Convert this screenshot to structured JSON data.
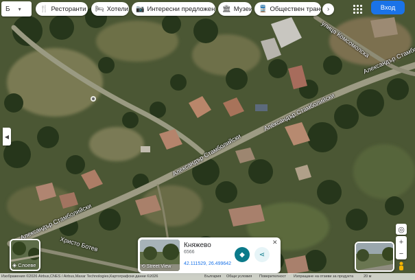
{
  "top": {
    "menu_glyph": "Б",
    "chips": [
      {
        "icon": "fork-knife-icon",
        "glyph": "🍴",
        "label": "Ресторанти"
      },
      {
        "icon": "bed-icon",
        "glyph": "🛏",
        "label": "Хотели"
      },
      {
        "icon": "camera-icon",
        "glyph": "📷",
        "label": "Интересни предложения"
      },
      {
        "icon": "bank-icon",
        "glyph": "🏛",
        "label": "Музеи"
      },
      {
        "icon": "train-icon",
        "glyph": "🚆",
        "label": "Обществен транспорт"
      }
    ],
    "signin_label": "Вход"
  },
  "roads": {
    "komsomolska": "улица Комсомолска",
    "stamboliyski": "Александър Стамболийски",
    "hristo_botev": "Христо Ботев"
  },
  "layers": {
    "label": "Слоеве"
  },
  "place_card": {
    "title": "Княжево",
    "postal_code": "6566",
    "coordinates": "42.111529, 26.499642",
    "thumb_label": "Street View"
  },
  "footer": {
    "attribution": "Изображения ©2026 Airbus,CNES / Airbus,Maxar Technologies,Картографски данни ©2026",
    "country": "България",
    "terms": "Общи условия",
    "privacy": "Поверителност",
    "feedback": "Изпращане на отзиви за продукта",
    "scale": "20 м"
  },
  "colors": {
    "accent": "#1a73e8",
    "action": "#0b7a8a"
  }
}
